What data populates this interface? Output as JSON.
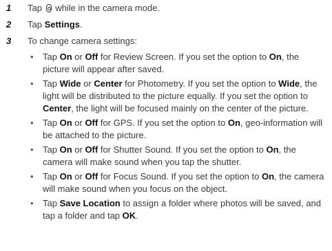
{
  "steps": [
    {
      "num": "1",
      "before": "Tap ",
      "icon": "camera-settings-icon",
      "after": " while in the camera mode."
    },
    {
      "num": "2",
      "before": "Tap ",
      "bold": "Settings",
      "after": "."
    },
    {
      "num": "3",
      "text": "To change camera settings:"
    }
  ],
  "bullet_char": "•",
  "bullets": [
    [
      {
        "t": "Tap "
      },
      {
        "b": "On"
      },
      {
        "t": " or "
      },
      {
        "b": "Off"
      },
      {
        "t": " for Review Screen. If you set the option to "
      },
      {
        "b": "On"
      },
      {
        "t": ", the picture will appear after saved."
      }
    ],
    [
      {
        "t": "Tap "
      },
      {
        "b": "Wide"
      },
      {
        "t": " or "
      },
      {
        "b": "Center"
      },
      {
        "t": " for Photometry. If you set the option to "
      },
      {
        "b": "Wide"
      },
      {
        "t": ", the light will be distributed to the picture equally. If you set the option to "
      },
      {
        "b": "Center"
      },
      {
        "t": ", the light will be focused mainly on the center of the picture."
      }
    ],
    [
      {
        "t": "Tap "
      },
      {
        "b": "On"
      },
      {
        "t": " or "
      },
      {
        "b": "Off"
      },
      {
        "t": " for GPS. If you set the option to "
      },
      {
        "b": "On"
      },
      {
        "t": ", geo-information will be attached to the picture."
      }
    ],
    [
      {
        "t": "Tap "
      },
      {
        "b": "On"
      },
      {
        "t": " or "
      },
      {
        "b": "Off"
      },
      {
        "t": " for Shutter Sound. If you set the option to "
      },
      {
        "b": "On"
      },
      {
        "t": ", the camera will make sound when you tap the shutter."
      }
    ],
    [
      {
        "t": "Tap "
      },
      {
        "b": "On"
      },
      {
        "t": " or "
      },
      {
        "b": "Off"
      },
      {
        "t": " for Focus Sound. If you set the option to "
      },
      {
        "b": "On"
      },
      {
        "t": ", the camera will make sound when you focus on the object."
      }
    ],
    [
      {
        "t": "Tap "
      },
      {
        "b": "Save Location"
      },
      {
        "t": " to assign a folder where photos will be saved, and tap a folder and tap "
      },
      {
        "b": "OK"
      },
      {
        "t": "."
      }
    ]
  ]
}
